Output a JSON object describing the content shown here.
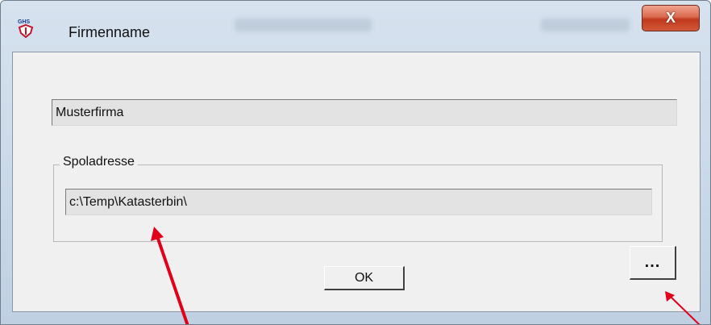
{
  "window": {
    "title": "Firmenname",
    "close_label": "X"
  },
  "main": {
    "company_name_value": "Musterfirma",
    "group_label": "Spoladresse",
    "path_value": "c:\\Temp\\Katasterbin\\",
    "ok_label": "OK",
    "browse_label": "..."
  },
  "colors": {
    "annotation_arrow": "#e0001a",
    "close_button": "#c0391c"
  },
  "icons": {
    "app_icon": "app-icon",
    "close_icon": "close-icon"
  }
}
